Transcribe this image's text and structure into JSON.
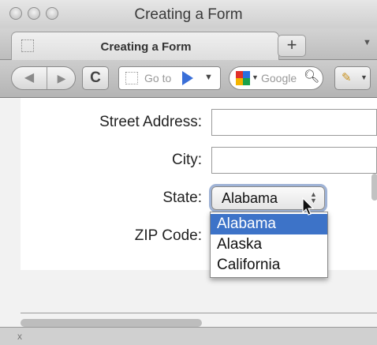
{
  "window": {
    "title": "Creating a Form"
  },
  "tabs": [
    {
      "label": "Creating a Form"
    }
  ],
  "new_tab": {
    "label": "+"
  },
  "toolbar": {
    "back_icon": "◀",
    "forward_icon": "▶",
    "reload_icon": "C",
    "url_placeholder": "Go to",
    "search_placeholder": "Google",
    "extension_icon": "✎"
  },
  "form": {
    "street_label": "Street Address:",
    "city_label": "City:",
    "state_label": "State:",
    "zip_label": "ZIP Code:",
    "state_selected": "Alabama",
    "state_options": [
      "Alabama",
      "Alaska",
      "California"
    ]
  },
  "statusbar": {
    "close_icon": "x"
  },
  "colors": {
    "selection": "#3d73c8",
    "focus_ring": "#9fb3d6",
    "google_logo": [
      "#e0302a",
      "#2a6fe0",
      "#f4b400",
      "#1aa24a"
    ]
  }
}
